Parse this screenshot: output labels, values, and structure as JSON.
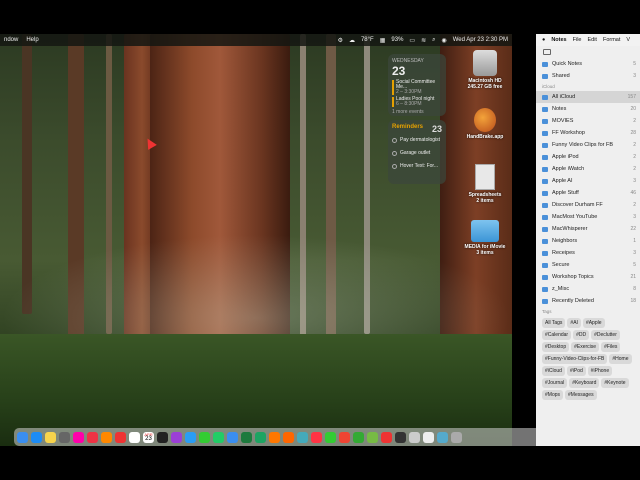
{
  "left_screen": {
    "menubar": {
      "items": [
        "ndow",
        "Help"
      ],
      "temperature": "78°F",
      "battery": "93%",
      "datetime": "Wed Apr 23 2:30 PM"
    },
    "calendar_widget": {
      "day": "WEDNESDAY",
      "date": "23",
      "events": [
        {
          "title": "Social Committee Me...",
          "time": "2 – 3:30PM"
        },
        {
          "title": "Ladies Pool night",
          "time": "6 – 8:30PM"
        }
      ],
      "more": "1 more events"
    },
    "reminders_widget": {
      "title": "Reminders",
      "count": "23",
      "items": [
        "Pay dermatologist",
        "Garage outlet",
        "Hover Text: For..."
      ]
    },
    "desktop_icons": [
      {
        "name": "Macintosh HD",
        "sub": "245.27 GB free",
        "icon": "hard-drive-icon"
      },
      {
        "name": "HandBrake.app",
        "sub": "",
        "icon": "handbrake-icon"
      },
      {
        "name": "Spreadsheets",
        "sub": "2 items",
        "icon": "spreadsheet-icon"
      },
      {
        "name": "MEDIA for iMovie",
        "sub": "3 items",
        "icon": "folder-icon"
      }
    ],
    "dock": {
      "calendar_date": "23",
      "calendar_month": "APR",
      "icons": [
        "finder-icon",
        "app-store-icon",
        "notes-icon",
        "launchpad-icon",
        "photos-icon",
        "chrome-icon",
        "firefox-icon",
        "gmail-icon",
        "reminders-icon",
        "calendar-icon",
        "tv-icon",
        "podcasts-icon",
        "safari-icon",
        "messages-icon",
        "numbers-icon",
        "keynote-icon",
        "excel-icon",
        "sheets-icon",
        "books-icon",
        "pages-icon",
        "preview-icon",
        "music-icon",
        "whatsapp-icon",
        "chrome2-icon",
        "camtasia-icon",
        "imovie-icon",
        "news-icon",
        "terminal-icon",
        "screenshot-icon",
        "textedit-icon",
        "downloads-icon",
        "trash-icon"
      ]
    }
  },
  "notes": {
    "menubar": [
      "Notes",
      "File",
      "Edit",
      "Format",
      "V"
    ],
    "pinned": [
      {
        "label": "Quick Notes",
        "count": "5"
      },
      {
        "label": "Shared",
        "count": "3"
      }
    ],
    "icloud_header": "iCloud",
    "folders": [
      {
        "label": "All iCloud",
        "count": "157",
        "selected": true
      },
      {
        "label": "Notes",
        "count": "20"
      },
      {
        "label": "MOVIES",
        "count": "2"
      },
      {
        "label": "FF Workshop",
        "count": "28"
      },
      {
        "label": "Funny Video Clips for FB",
        "count": "2"
      },
      {
        "label": "Apple iPod",
        "count": "2"
      },
      {
        "label": "Apple iWatch",
        "count": "2"
      },
      {
        "label": "Apple AI",
        "count": "3"
      },
      {
        "label": "Apple Stuff",
        "count": "46"
      },
      {
        "label": "Discover Durham FF",
        "count": "2"
      },
      {
        "label": "MacMost YouTube",
        "count": "3"
      },
      {
        "label": "MacWhisperer",
        "count": "22"
      },
      {
        "label": "Neighbors",
        "count": "1"
      },
      {
        "label": "Receipes",
        "count": "3"
      },
      {
        "label": "Secure",
        "count": "5"
      },
      {
        "label": "Workshop Topics",
        "count": "21"
      },
      {
        "label": "z_Misc",
        "count": "8"
      },
      {
        "label": "Recently Deleted",
        "count": "18"
      }
    ],
    "tags_header": "Tags",
    "tags": [
      "All Tags",
      "#AI",
      "#Apple",
      "#Calendar",
      "#DD",
      "#Declutter",
      "#Desktop",
      "#Exercise",
      "#Files",
      "#Funny-Video-Clips-for-FB",
      "#Home",
      "#iCloud",
      "#iPod",
      "#iPhone",
      "#Journal",
      "#Keyboard",
      "#Keynote",
      "#Mops",
      "#Messages"
    ]
  },
  "colors": {
    "accent": "#4a90d9",
    "selected_row": "#d5d5d5"
  }
}
